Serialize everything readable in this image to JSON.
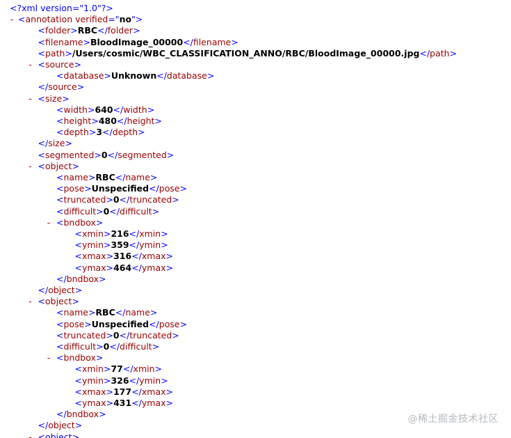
{
  "xml_declaration": "<?xml version=\"1.0\"?>",
  "toggle_symbol": "-",
  "annotation": {
    "tag": "annotation",
    "attr_name": "verified",
    "attr_value": "no"
  },
  "tags": {
    "folder": "folder",
    "filename": "filename",
    "path": "path",
    "source": "source",
    "database": "database",
    "size": "size",
    "width": "width",
    "height": "height",
    "depth": "depth",
    "segmented": "segmented",
    "object": "object",
    "name": "name",
    "pose": "pose",
    "truncated": "truncated",
    "difficult": "difficult",
    "bndbox": "bndbox",
    "xmin": "xmin",
    "ymin": "ymin",
    "xmax": "xmax",
    "ymax": "ymax"
  },
  "folder": "RBC",
  "filename": "BloodImage_00000",
  "path": "/Users/cosmic/WBC_CLASSIFICATION_ANNO/RBC/BloodImage_00000.jpg",
  "source": {
    "database": "Unknown"
  },
  "size": {
    "width": "640",
    "height": "480",
    "depth": "3"
  },
  "segmented": "0",
  "objects": [
    {
      "name": "RBC",
      "pose": "Unspecified",
      "truncated": "0",
      "difficult": "0",
      "bndbox": {
        "xmin": "216",
        "ymin": "359",
        "xmax": "316",
        "ymax": "464"
      }
    },
    {
      "name": "RBC",
      "pose": "Unspecified",
      "truncated": "0",
      "difficult": "0",
      "bndbox": {
        "xmin": "77",
        "ymin": "326",
        "xmax": "177",
        "ymax": "431"
      }
    }
  ],
  "partial_next_tag": "<object>",
  "watermark": "@稀土掘金技术社区"
}
